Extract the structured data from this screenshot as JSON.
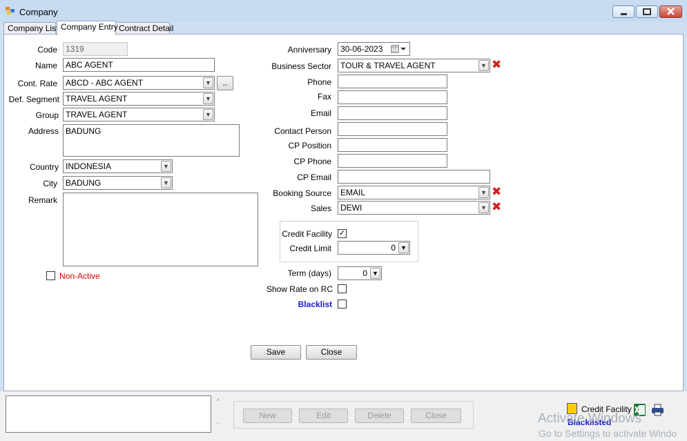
{
  "window": {
    "title": "Company"
  },
  "tabs": [
    "Company List",
    "Company Entry",
    "Contract Detail"
  ],
  "form_left": {
    "code_label": "Code",
    "code_value": "1319",
    "name_label": "Name",
    "name_value": "ABC AGENT",
    "cont_rate_label": "Cont. Rate",
    "cont_rate_value": "ABCD - ABC AGENT",
    "cont_rate_button": "..",
    "def_segment_label": "Def. Segment",
    "def_segment_value": "TRAVEL AGENT",
    "group_label": "Group",
    "group_value": "TRAVEL AGENT",
    "address_label": "Address",
    "address_value": "BADUNG",
    "country_label": "Country",
    "country_value": "INDONESIA",
    "city_label": "City",
    "city_value": "BADUNG",
    "remark_label": "Remark",
    "remark_value": "",
    "non_active_label": "Non-Active",
    "non_active_checked": false
  },
  "form_right": {
    "anniversary_label": "Anniversary",
    "anniversary_value": "30-06-2023",
    "business_sector_label": "Business Sector",
    "business_sector_value": "TOUR & TRAVEL AGENT",
    "phone_label": "Phone",
    "phone_value": "",
    "fax_label": "Fax",
    "fax_value": "",
    "email_label": "Email",
    "email_value": "",
    "contact_person_label": "Contact Person",
    "contact_person_value": "",
    "cp_position_label": "CP Position",
    "cp_position_value": "",
    "cp_phone_label": "CP Phone",
    "cp_phone_value": "",
    "cp_email_label": "CP Email",
    "cp_email_value": "",
    "booking_source_label": "Booking Source",
    "booking_source_value": "EMAIL",
    "sales_label": "Sales",
    "sales_value": "DEWI",
    "credit_facility_label": "Credit Facility",
    "credit_facility_checked": true,
    "credit_facility_mark": "✓",
    "credit_limit_label": "Credit Limit",
    "credit_limit_value": "0",
    "term_label": "Term (days)",
    "term_value": "0",
    "show_rate_label": "Show Rate on RC",
    "show_rate_checked": false,
    "blacklist_label": "Blacklist",
    "blacklist_checked": false
  },
  "form_buttons": {
    "save": "Save",
    "close": "Close"
  },
  "bottom": {
    "new": "New",
    "edit": "Edit",
    "delete": "Delete",
    "close": "Close",
    "legend_credit_facility": "Credit Facility",
    "legend_blacklisted": "Blacklisted",
    "watermark_title": "Activate Windows",
    "watermark_sub": "Go to Settings to activate Windo"
  },
  "colors": {
    "non_active": "#e00000",
    "blacklist": "#1a1acc",
    "remove_icon": "#d42020",
    "credit_swatch": "#ffcc00"
  }
}
